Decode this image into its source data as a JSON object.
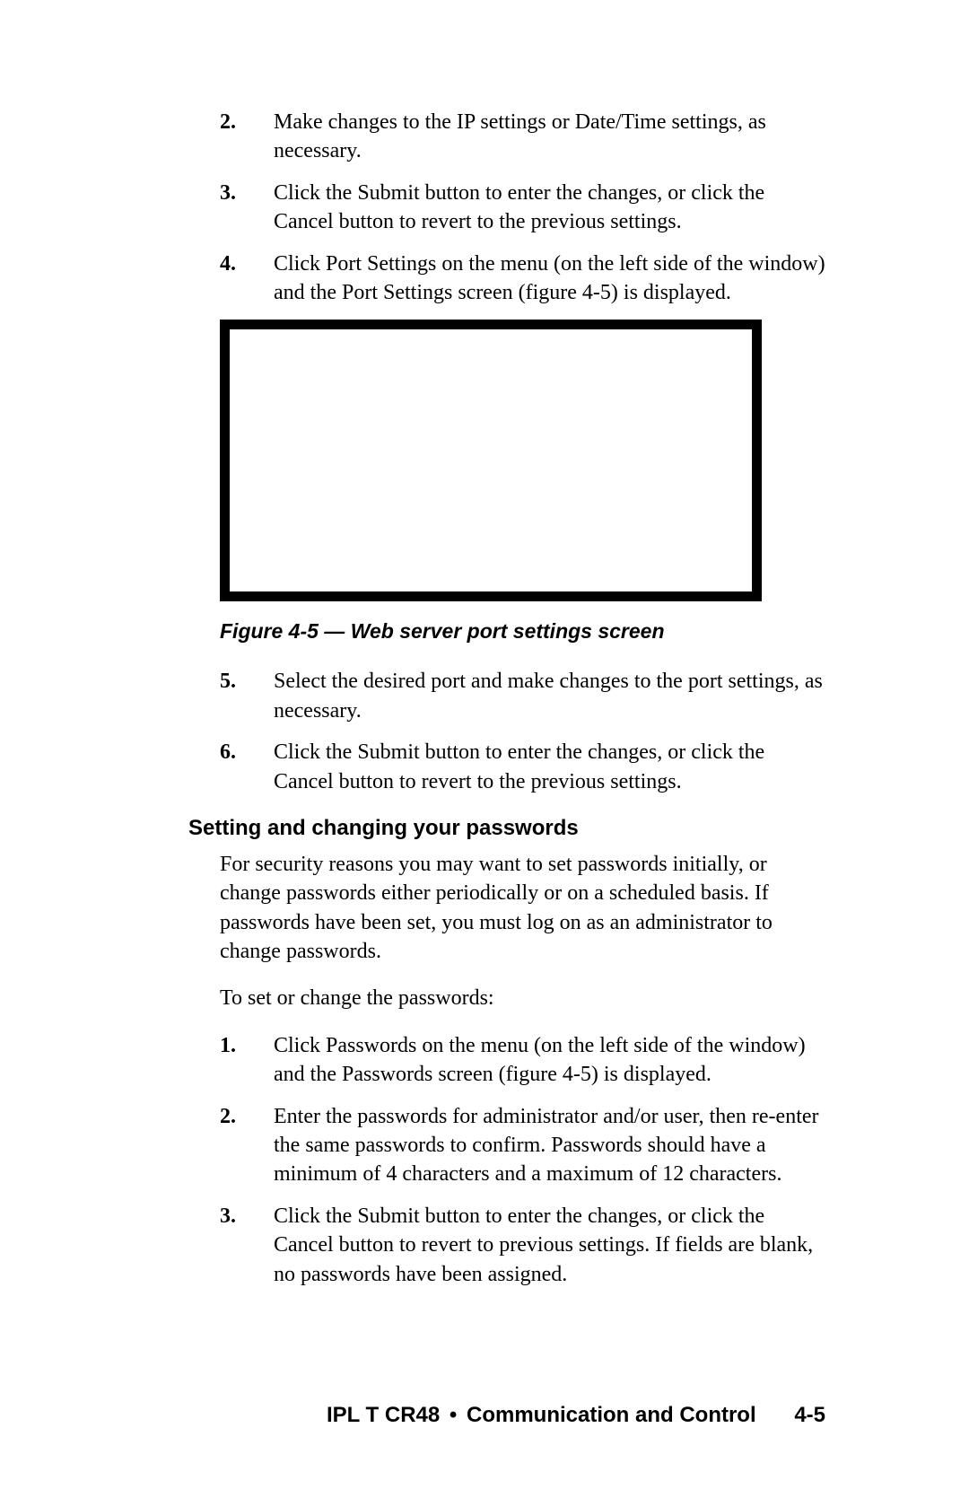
{
  "steps_a": [
    {
      "num": "2.",
      "text": "Make changes to the IP settings or Date/Time settings, as necessary."
    },
    {
      "num": "3.",
      "text": "Click the Submit button to enter the changes, or click the Cancel button to revert to the previous settings."
    },
    {
      "num": "4.",
      "text": "Click Port Settings on the menu (on the left side of the window) and the Port Settings screen (figure 4-5) is displayed."
    }
  ],
  "figure_caption": "Figure 4-5 — Web server port settings screen",
  "steps_b": [
    {
      "num": "5.",
      "text": "Select the desired port and make changes to the port settings, as necessary."
    },
    {
      "num": "6.",
      "text": "Click the Submit button to enter the changes, or click the Cancel button to revert to the previous settings."
    }
  ],
  "section_heading": "Setting and changing your passwords",
  "section_intro": "For security reasons you may want to set passwords initially, or change passwords either periodically or on a scheduled basis.  If passwords have been set, you must log on as an administrator to change passwords.",
  "section_lead": "To set or change the passwords:",
  "steps_c": [
    {
      "num": "1.",
      "text": "Click Passwords on the menu (on the left side of the window) and the Passwords screen (figure 4-5) is displayed."
    },
    {
      "num": "2.",
      "text": "Enter the passwords for administrator and/or user, then re-enter the same passwords to confirm.  Passwords should have a minimum of 4 characters and a maximum of 12 characters."
    },
    {
      "num": "3.",
      "text": "Click the Submit button to enter the changes, or click the Cancel button to revert to previous settings.  If fields are blank, no passwords have been assigned."
    }
  ],
  "footer": {
    "product": "IPL T CR48",
    "dot": "•",
    "chapter": "Communication and Control",
    "page": "4-5"
  }
}
